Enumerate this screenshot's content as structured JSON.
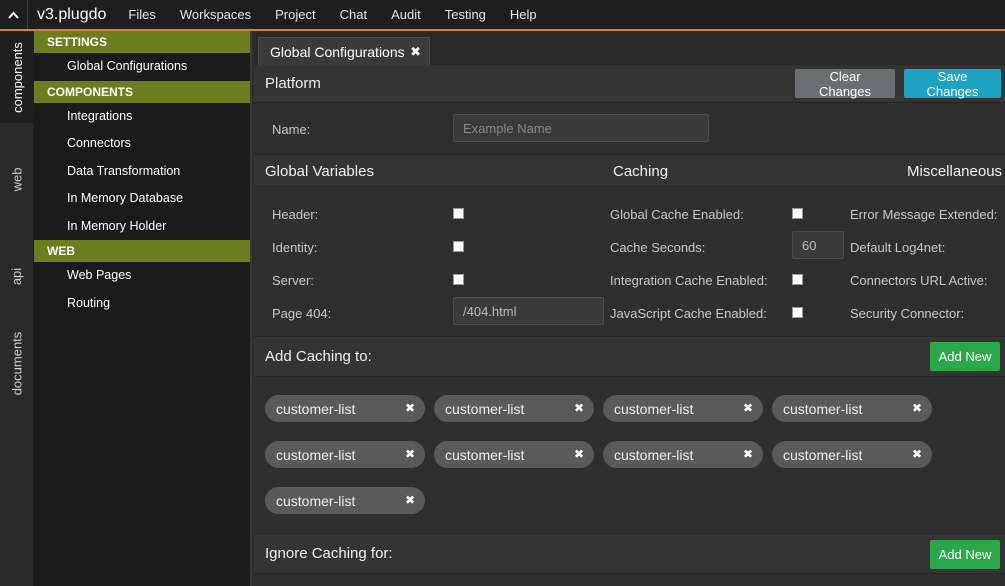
{
  "topbar": {
    "collapse_icon": "chevron-up-icon",
    "brand": "v3.plugdo",
    "menu": [
      "Files",
      "Workspaces",
      "Project",
      "Chat",
      "Audit",
      "Testing",
      "Help"
    ]
  },
  "vtabs": [
    "components",
    "web",
    "api",
    "documents"
  ],
  "sidebar": {
    "settings_header": "SETTINGS",
    "settings_items": [
      "Global Configurations"
    ],
    "components_header": "COMPONENTS",
    "components_items": [
      "Integrations",
      "Connectors",
      "Data Transformation",
      "In Memory Database",
      "In Memory Holder"
    ],
    "web_header": "WEB",
    "web_items": [
      "Web Pages",
      "Routing"
    ]
  },
  "tab": {
    "label": "Global Configurations",
    "close": "✖"
  },
  "platform": {
    "title": "Platform",
    "clear_label": "Clear Changes",
    "save_label": "Save Changes",
    "name_label": "Name:",
    "name_placeholder": "Example Name"
  },
  "columns": {
    "global_variables": "Global Variables",
    "caching": "Caching",
    "miscellaneous": "Miscellaneous"
  },
  "global_variables": {
    "header": "Header:",
    "identity": "Identity:",
    "server": "Server:",
    "page404": "Page 404:",
    "page404_value": "/404.html"
  },
  "caching": {
    "global_cache": "Global Cache Enabled:",
    "cache_seconds": "Cache Seconds:",
    "cache_seconds_value": "60",
    "integration_cache": "Integration Cache Enabled:",
    "js_cache": "JavaScript Cache Enabled:"
  },
  "misc": {
    "error_message": "Error Message Extended:",
    "default_log": "Default Log4net:",
    "connectors_url": "Connectors URL Active:",
    "security": "Security Connector:"
  },
  "add_caching": {
    "title": "Add Caching to:",
    "add_label": "Add New",
    "chips": [
      "customer-list",
      "customer-list",
      "customer-list",
      "customer-list",
      "customer-list",
      "customer-list",
      "customer-list",
      "customer-list",
      "customer-list"
    ],
    "chip_close": "✖"
  },
  "ignore_caching": {
    "title": "Ignore Caching for:",
    "add_label": "Add New"
  },
  "colors": {
    "accent_orange": "#d9822b",
    "sidebar_header": "#6b7d1c",
    "save_button": "#1fa3c4",
    "add_button": "#2aa84a"
  }
}
